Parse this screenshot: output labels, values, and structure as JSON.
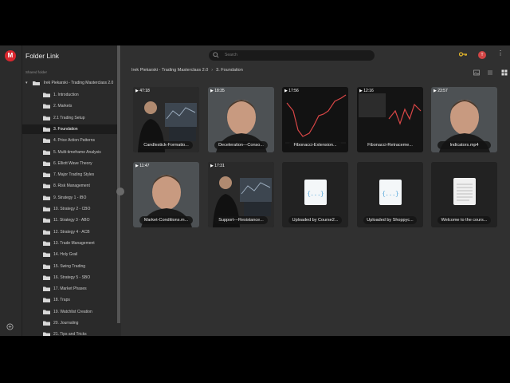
{
  "app": {
    "logo_letter": "M",
    "title": "Folder Link",
    "brand_color": "#d9272e"
  },
  "sidebar": {
    "shared_label": "Shared folder",
    "root_label": "Irek Piekarski - Trading Masterclass 2.0",
    "items": [
      {
        "label": "1. Introduction"
      },
      {
        "label": "2. Markets"
      },
      {
        "label": "2.1 Trading Setup"
      },
      {
        "label": "3. Foundation",
        "selected": true
      },
      {
        "label": "4. Price Action Patterns"
      },
      {
        "label": "5. Multi-timeframe Analysis"
      },
      {
        "label": "6. Elliott Wave Theory"
      },
      {
        "label": "7. Major Trading Styles"
      },
      {
        "label": "8. Risk Management"
      },
      {
        "label": "9. Strategy 1 - IBO"
      },
      {
        "label": "10. Strategy 2 - CBO"
      },
      {
        "label": "11. Strategy 3 - ABO"
      },
      {
        "label": "12. Strategy 4 - ACB"
      },
      {
        "label": "13. Trade Management"
      },
      {
        "label": "14. Holy Grail"
      },
      {
        "label": "15. Swing Trading"
      },
      {
        "label": "16. Strategy 5 - SBO"
      },
      {
        "label": "17. Market Phases"
      },
      {
        "label": "18. Traps"
      },
      {
        "label": "19. Watchlist Creation"
      },
      {
        "label": "20. Journaling"
      },
      {
        "label": "21. Tips and Tricks"
      }
    ]
  },
  "topbar": {
    "search_placeholder": "Search",
    "avatar_letter": "T"
  },
  "breadcrumb": {
    "root": "Irek Piekarski - Trading Masterclass 2.0",
    "current": "3. Foundation",
    "separator": "›"
  },
  "files": [
    {
      "name": "Candlestick-Formatio...",
      "duration": "▶ 47:18",
      "kind": "video-person-desk"
    },
    {
      "name": "Deceleration---Conso...",
      "duration": "▶ 18:35",
      "kind": "video-face"
    },
    {
      "name": "Fibonacci-Extension...",
      "duration": "▶ 17:56",
      "kind": "video-chart"
    },
    {
      "name": "Fibonacci-Retraceme...",
      "duration": "▶ 12:16",
      "kind": "video-chart2"
    },
    {
      "name": "Indicators.mp4",
      "duration": "▶ 23:57",
      "kind": "video-face2"
    },
    {
      "name": "Market-Conditions.m...",
      "duration": "▶ 11:47",
      "kind": "video-face3"
    },
    {
      "name": "Support---Resistance...",
      "duration": "▶ 17:31",
      "kind": "video-person-desk2"
    },
    {
      "name": "Uploaded by Course2...",
      "duration": "",
      "kind": "code-file"
    },
    {
      "name": "Uploaded by Shoppyc...",
      "duration": "",
      "kind": "code-file"
    },
    {
      "name": "Welcome to the cours...",
      "duration": "",
      "kind": "text-file"
    }
  ]
}
